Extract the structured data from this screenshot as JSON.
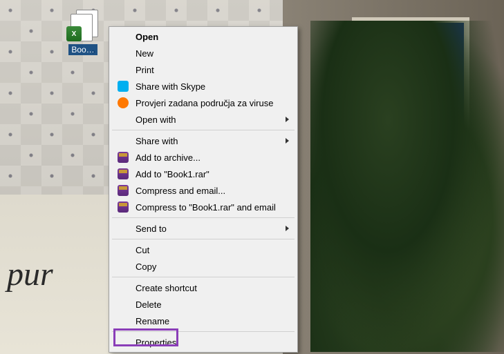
{
  "desktop": {
    "icon": {
      "label": "Boo…",
      "badge": "X",
      "name": "excel-file-icon"
    },
    "script_text": "pur"
  },
  "context_menu": {
    "items": [
      {
        "label": "Open",
        "bold": true,
        "icon": null,
        "submenu": false
      },
      {
        "label": "New",
        "icon": null,
        "submenu": false
      },
      {
        "label": "Print",
        "icon": null,
        "submenu": false
      },
      {
        "label": "Share with Skype",
        "icon": "skype",
        "submenu": false
      },
      {
        "label": "Provjeri zadana područja za viruse",
        "icon": "avast",
        "submenu": false
      },
      {
        "label": "Open with",
        "icon": null,
        "submenu": true
      },
      {
        "separator": true
      },
      {
        "label": "Share with",
        "icon": null,
        "submenu": true
      },
      {
        "label": "Add to archive...",
        "icon": "rar",
        "submenu": false
      },
      {
        "label": "Add to \"Book1.rar\"",
        "icon": "rar",
        "submenu": false
      },
      {
        "label": "Compress and email...",
        "icon": "rar",
        "submenu": false
      },
      {
        "label": "Compress to \"Book1.rar\" and email",
        "icon": "rar",
        "submenu": false
      },
      {
        "separator": true
      },
      {
        "label": "Send to",
        "icon": null,
        "submenu": true
      },
      {
        "separator": true
      },
      {
        "label": "Cut",
        "icon": null,
        "submenu": false
      },
      {
        "label": "Copy",
        "icon": null,
        "submenu": false
      },
      {
        "separator": true
      },
      {
        "label": "Create shortcut",
        "icon": null,
        "submenu": false
      },
      {
        "label": "Delete",
        "icon": null,
        "submenu": false
      },
      {
        "label": "Rename",
        "icon": null,
        "submenu": false
      },
      {
        "separator": true
      },
      {
        "label": "Properties",
        "icon": null,
        "submenu": false
      }
    ]
  },
  "highlight_color": "#8a3db8"
}
